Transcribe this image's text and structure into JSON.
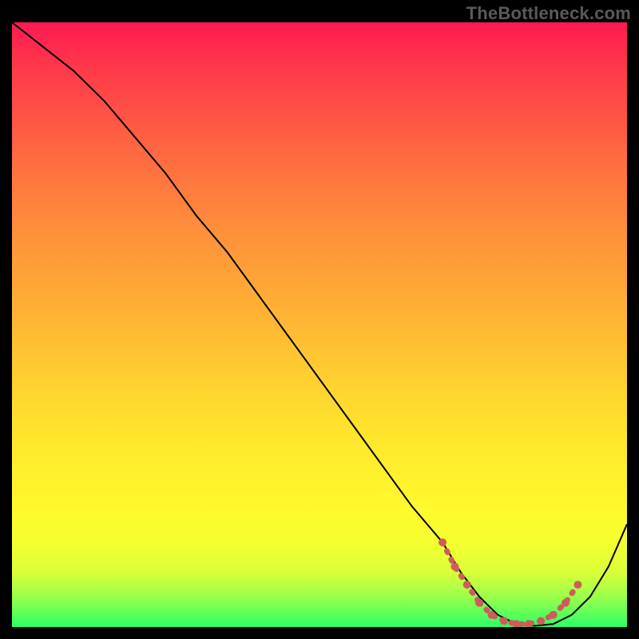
{
  "watermark": "TheBottleneck.com",
  "chart_data": {
    "type": "line",
    "title": "",
    "xlabel": "",
    "ylabel": "",
    "xlim": [
      0,
      100
    ],
    "ylim": [
      0,
      100
    ],
    "grid": false,
    "legend": false,
    "series": [
      {
        "name": "bottleneck-curve",
        "color": "#000000",
        "x": [
          0,
          5,
          10,
          15,
          20,
          25,
          30,
          35,
          40,
          45,
          50,
          55,
          60,
          65,
          70,
          73,
          76,
          79,
          82,
          85,
          88,
          91,
          94,
          97,
          100
        ],
        "y": [
          100,
          96,
          92,
          87,
          81,
          75,
          68,
          62,
          55,
          48,
          41,
          34,
          27,
          20,
          14,
          9,
          5,
          2,
          0.5,
          0.2,
          0.5,
          2,
          5,
          10,
          17
        ]
      },
      {
        "name": "optimal-band-left",
        "color": "#ce5c5c",
        "x": [
          70,
          72,
          74,
          76
        ],
        "y": [
          14,
          10,
          7,
          4
        ]
      },
      {
        "name": "optimal-band-bottom",
        "color": "#ce5c5c",
        "x": [
          76,
          78,
          80,
          82,
          84,
          86,
          88
        ],
        "y": [
          4,
          2,
          1,
          0.5,
          0.5,
          1,
          2
        ]
      },
      {
        "name": "optimal-band-right",
        "color": "#ce5c5c",
        "x": [
          88,
          90,
          92
        ],
        "y": [
          2,
          4,
          7
        ]
      }
    ],
    "gradient_stops": [
      {
        "pos": 0,
        "color": "#ff1a52"
      },
      {
        "pos": 8,
        "color": "#ff3a4a"
      },
      {
        "pos": 22,
        "color": "#ff6a40"
      },
      {
        "pos": 35,
        "color": "#ff913a"
      },
      {
        "pos": 48,
        "color": "#ffb234"
      },
      {
        "pos": 60,
        "color": "#ffd22f"
      },
      {
        "pos": 70,
        "color": "#ffe92c"
      },
      {
        "pos": 80,
        "color": "#fff92c"
      },
      {
        "pos": 86,
        "color": "#f6ff30"
      },
      {
        "pos": 91,
        "color": "#d9ff38"
      },
      {
        "pos": 95,
        "color": "#9aff4a"
      },
      {
        "pos": 100,
        "color": "#2bff66"
      }
    ]
  }
}
